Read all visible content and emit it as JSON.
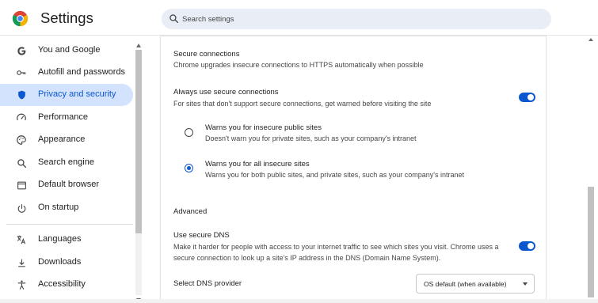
{
  "header": {
    "app_title": "Settings",
    "logo_icon": "chrome-logo-icon",
    "search": {
      "placeholder": "Search settings",
      "icon": "search-icon"
    }
  },
  "sidebar": {
    "items": [
      {
        "label": "You and Google",
        "icon": "google-g-icon",
        "active": false
      },
      {
        "label": "Autofill and passwords",
        "icon": "key-icon",
        "active": false
      },
      {
        "label": "Privacy and security",
        "icon": "shield-icon",
        "active": true
      },
      {
        "label": "Performance",
        "icon": "speedometer-icon",
        "active": false
      },
      {
        "label": "Appearance",
        "icon": "palette-icon",
        "active": false
      },
      {
        "label": "Search engine",
        "icon": "search-icon",
        "active": false
      },
      {
        "label": "Default browser",
        "icon": "browser-window-icon",
        "active": false
      },
      {
        "label": "On startup",
        "icon": "power-icon",
        "active": false
      },
      {
        "label": "Languages",
        "icon": "translate-icon",
        "active": false
      },
      {
        "label": "Downloads",
        "icon": "download-icon",
        "active": false
      },
      {
        "label": "Accessibility",
        "icon": "accessibility-icon",
        "active": false
      }
    ]
  },
  "main": {
    "secure_connections": {
      "title": "Secure connections",
      "description": "Chrome upgrades insecure connections to HTTPS automatically when possible"
    },
    "always_secure": {
      "label": "Always use secure connections",
      "description": "For sites that don't support secure connections, get warned before visiting the site",
      "enabled": true
    },
    "radio_options": [
      {
        "title": "Warns you for insecure public sites",
        "description": "Doesn't warn you for private sites, such as your company's intranet",
        "selected": false
      },
      {
        "title": "Warns you for all insecure sites",
        "description": "Warns you for both public sites, and private sites, such as your company's intranet",
        "selected": true
      }
    ],
    "advanced": {
      "title": "Advanced"
    },
    "secure_dns": {
      "label": "Use secure DNS",
      "description_line1": "Make it harder for people with access to your internet traffic to see which sites you visit. Chrome uses a",
      "description_line2": "secure connection to look up a site's IP address in the DNS (Domain Name System).",
      "enabled": true
    },
    "dns_provider": {
      "label": "Select DNS provider",
      "selected": "OS default (when available)"
    }
  },
  "colors": {
    "accent": "#0b57d0",
    "active_nav_bg": "#d3e3fd",
    "search_bg": "#e9eef6"
  }
}
